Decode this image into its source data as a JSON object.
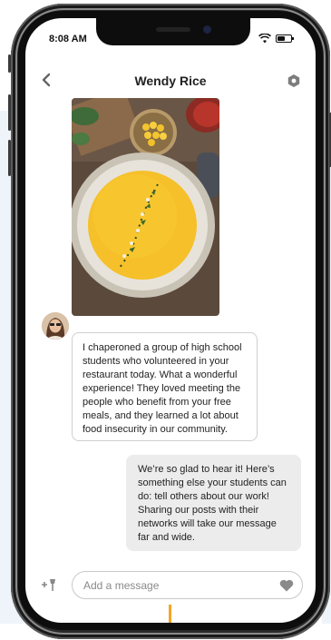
{
  "status_bar": {
    "time": "8:08 AM",
    "battery_level": 0.6
  },
  "header": {
    "title": "Wendy Rice"
  },
  "icons": {
    "back": "chevron-left-icon",
    "settings": "hexagon-settings-icon",
    "attach": "plus-pin-icon",
    "like": "heart-icon"
  },
  "messages": [
    {
      "direction": "incoming",
      "type": "image",
      "image": "photo of a bowl of yellow soup with corn and herbs"
    },
    {
      "direction": "incoming",
      "type": "text",
      "text": "I chaperoned a group of high school students who volunteered in your restaurant today. What a wonderful experience! They loved meeting the people who benefit from your free meals, and they learned a lot about food insecurity in our community."
    },
    {
      "direction": "outgoing",
      "type": "text",
      "text": "We’re so glad to hear it! Here’s something else your students can do: tell others about our work! Sharing our posts with their networks will take our message far and wide."
    }
  ],
  "composer": {
    "placeholder": "Add a message",
    "value": ""
  },
  "colors": {
    "accent": "#f5a623",
    "outgoing_bubble": "#ececec",
    "border": "#cfcfcf"
  }
}
